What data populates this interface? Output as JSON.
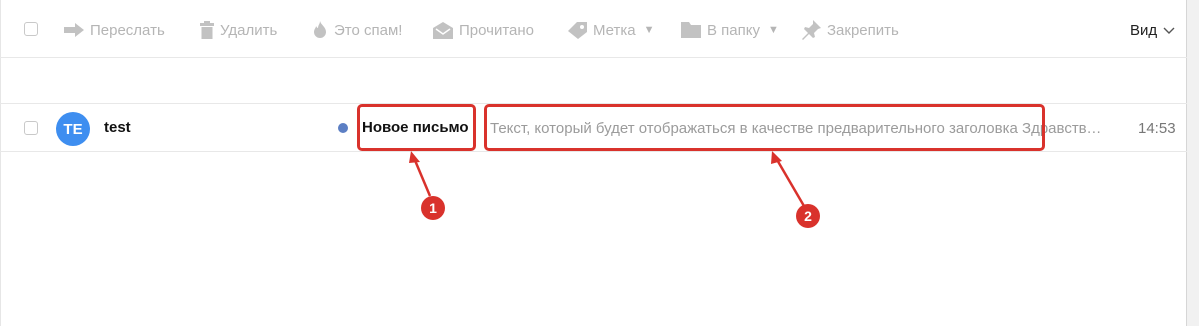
{
  "toolbar": {
    "forward_label": "Переслать",
    "delete_label": "Удалить",
    "spam_label": "Это спам!",
    "read_label": "Прочитано",
    "tag_label": "Метка",
    "folder_label": "В папку",
    "pin_label": "Закрепить",
    "view_label": "Вид",
    "icons": [
      "arrow-right-icon",
      "trash-icon",
      "fire-icon",
      "open-envelope-icon",
      "tag-icon",
      "folder-icon",
      "pin-icon",
      "chevron-down-icon"
    ]
  },
  "message": {
    "avatar_initials": "TE",
    "avatar_color": "#3e8ef0",
    "sender": "test",
    "subject": "Новое письмо",
    "preview": "Текст, который будет отображаться в качестве предварительного заголовка Здравствуйте!",
    "time": "14:53",
    "unread": true
  },
  "annotations": {
    "color": "#d9322c",
    "labels": [
      "1",
      "2"
    ]
  }
}
